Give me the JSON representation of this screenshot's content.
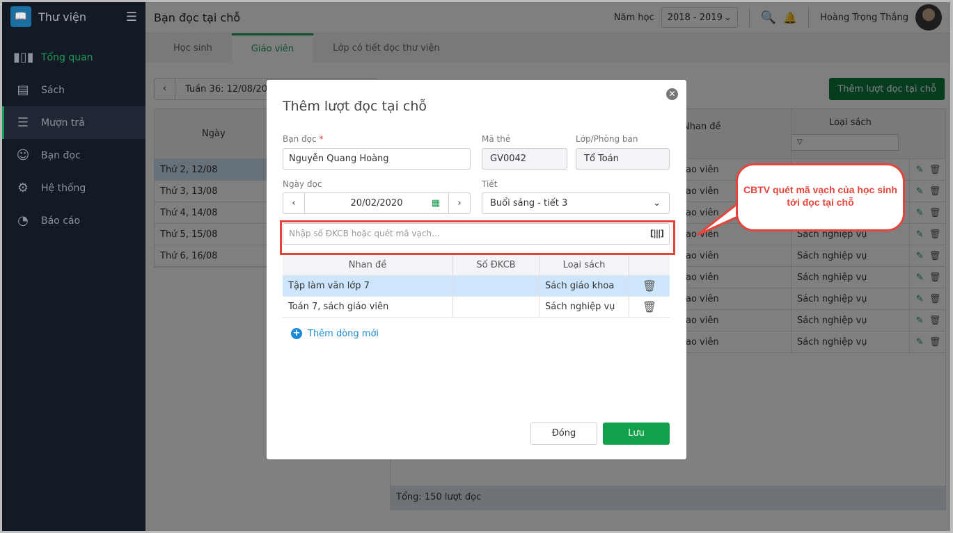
{
  "sidebar": {
    "app_name": "Thư viện",
    "items": [
      {
        "label": "Tổng quan",
        "icon": "bar-chart-icon"
      },
      {
        "label": "Sách",
        "icon": "book-icon"
      },
      {
        "label": "Mượn trả",
        "icon": "borrow-icon"
      },
      {
        "label": "Bạn đọc",
        "icon": "reader-icon"
      },
      {
        "label": "Hệ thống",
        "icon": "gear-icon"
      },
      {
        "label": "Báo cáo",
        "icon": "pie-chart-icon"
      }
    ]
  },
  "header": {
    "title": "Bạn đọc tại chỗ",
    "year_label": "Năm học",
    "year_value": "2018 - 2019",
    "user_name": "Hoàng Trọng  Thắng"
  },
  "tabs": [
    "Học sinh",
    "Giáo viên",
    "Lớp có tiết đọc thư viện"
  ],
  "content": {
    "week": "Tuần 36: 12/08/2019",
    "add_button": "Thêm lượt đọc tại chỗ",
    "day_header": "Ngày",
    "days": [
      "Thứ 2, 12/08",
      "Thứ 3, 13/08",
      "Thứ 4, 14/08",
      "Thứ 5, 15/08",
      "Thứ 6, 16/08"
    ],
    "col_title": "Nhan đề",
    "col_type": "Loại sách",
    "rows": [
      {
        "title": "ao viên",
        "type": ""
      },
      {
        "title": "ao viên",
        "type": ""
      },
      {
        "title": "ao viên",
        "type": ""
      },
      {
        "title": "ao viên",
        "type": "Sách nghiệp vụ"
      },
      {
        "title": "ao viên",
        "type": "Sách nghiệp vụ"
      },
      {
        "title": "ao viên",
        "type": "Sách nghiệp vụ"
      },
      {
        "title": "ao viên",
        "type": "Sách nghiệp vụ"
      },
      {
        "title": "ao viên",
        "type": "Sách nghiệp vụ"
      },
      {
        "title": "ao viên",
        "type": "Sách nghiệp vụ"
      }
    ],
    "footer": "Tổng: 150 lượt đọc"
  },
  "modal": {
    "title": "Thêm lượt đọc tại chỗ",
    "reader_label": "Bạn đọc",
    "required": "*",
    "reader_value": "Nguyễn Quang Hoàng",
    "card_label": "Mã thẻ",
    "card_value": "GV0042",
    "class_label": "Lớp/Phòng ban",
    "class_value": "Tổ Toán",
    "date_label": "Ngày đọc",
    "date_value": "20/02/2020",
    "period_label": "Tiết",
    "period_value": "Buổi sáng -  tiết 3",
    "scan_placeholder": "Nhập số ĐKCB hoặc quét mã vạch...",
    "headers": [
      "Nhan đề",
      "Số ĐKCB",
      "Loại sách"
    ],
    "books": [
      {
        "title": "Tập làm văn lớp 7",
        "code": "",
        "type": "Sách giáo khoa"
      },
      {
        "title": "Toán 7, sách giáo viên",
        "code": "",
        "type": "Sách nghiệp vụ"
      }
    ],
    "add_row": "Thêm dòng mới",
    "close_button": "Đóng",
    "save_button": "Lưu"
  },
  "callout": {
    "text": "CBTV quét mã vạch của học sinh tới đọc tại chỗ"
  },
  "colors": {
    "accent": "#1f9a55",
    "highlight": "#e5443a",
    "link": "#1a8ad8"
  }
}
